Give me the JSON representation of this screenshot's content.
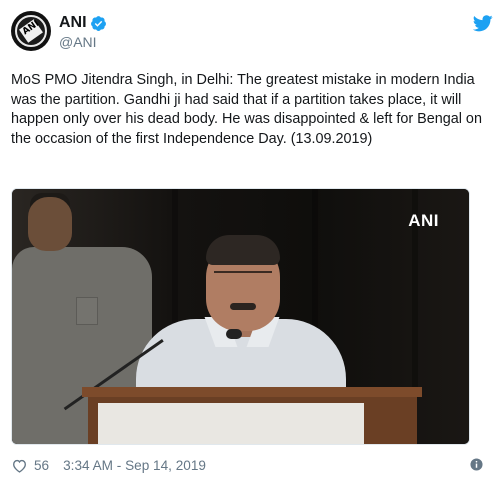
{
  "account": {
    "display_name": "ANI",
    "handle": "@ANI",
    "avatar_text": "ANI",
    "verified": true
  },
  "tweet": {
    "text": "MoS PMO Jitendra Singh, in Delhi: The greatest mistake in modern India was the partition. Gandhi ji had said that if a partition takes place, it will happen only over his dead body. He was disappointed & left for Bengal on the occasion of the first Independence Day. (13.09.2019)",
    "media_watermark": "ANI"
  },
  "footer": {
    "likes": "56",
    "timestamp": "3:34 AM - Sep 14, 2019"
  },
  "icons": {
    "brand": "twitter-bird-icon",
    "verified": "verified-badge-icon",
    "like": "heart-icon",
    "info": "info-icon"
  },
  "colors": {
    "brand_blue": "#1da1f2",
    "text": "#14171a",
    "secondary_text": "#657786"
  }
}
